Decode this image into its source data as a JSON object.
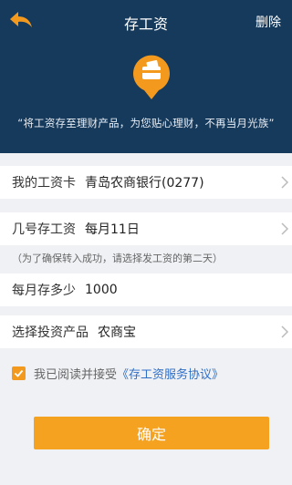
{
  "header": {
    "title": "存工资",
    "delete_label": "删除",
    "slogan": "“将工资存至理财产品，为您贴心理财，不再当月光族”"
  },
  "form": {
    "salary_card": {
      "label": "我的工资卡",
      "value": "青岛农商银行(0277)"
    },
    "deposit_day": {
      "label": "几号存工资",
      "value": "每月11日"
    },
    "hint": "（为了确保转入成功，请选择发工资的第二天）",
    "monthly_amount": {
      "label": "每月存多少",
      "value": "1000"
    },
    "product": {
      "label": "选择投资产品",
      "value": "农商宝"
    }
  },
  "agreement": {
    "checked": true,
    "text": "我已阅读并接受",
    "link": "《存工资服务协议》"
  },
  "confirm_label": "确定",
  "colors": {
    "header_bg": "#163a5c",
    "accent": "#f4a21f",
    "link": "#2f6fc8"
  },
  "icons": {
    "back": "back-arrow-icon",
    "badge": "wallet-card-icon",
    "chevron": "chevron-right-icon",
    "check": "checkmark-icon"
  }
}
